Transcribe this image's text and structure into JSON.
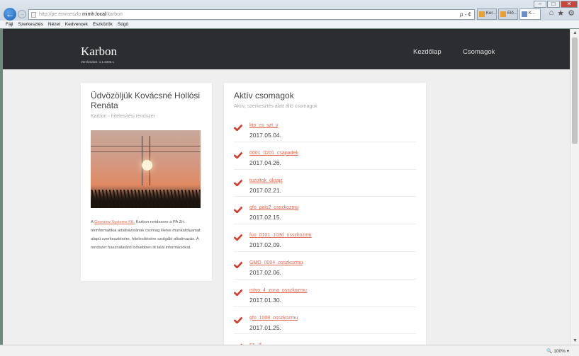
{
  "browser": {
    "address_prefix": "http://",
    "address_path_before": "pe.emmeszlo.",
    "address_host": "mimh.local",
    "address_path_after": "/karbon",
    "tools": "ρ - ¢",
    "tabs": [
      {
        "label": "Ker..."
      },
      {
        "label": "Elő..."
      },
      {
        "label": "K..."
      }
    ],
    "menu": [
      "Fájl",
      "Szerkesztés",
      "Nézet",
      "Kedvencek",
      "Eszközök",
      "Súgó"
    ],
    "zoom": "100%"
  },
  "site": {
    "title": "Karbon",
    "version": "Verziószám: 1.1.2203.1",
    "nav": {
      "home": "Kezdőlap",
      "packages": "Csomagok"
    }
  },
  "welcome": {
    "title": "Üdvözöljük Kovácsné Hollósi Renáta",
    "subtitle": "Karbon - hitelesítési rendszer",
    "desc_prefix": "A ",
    "desc_link": "Geoview Systems Kft.",
    "desc_rest": " Karbon rendszere a PA Zrt. térinformatikai adatbázisának csomag illetve munkafolyamat alapú szerkesztésére, hitelesítésére szolgáló alkalmazás. A rendszer használatáról bővebben itt talál információkat."
  },
  "packages": {
    "title": "Aktív csomagok",
    "subtitle": "Aktív, szerkesztés alatt álló csomagok",
    "items": [
      {
        "name": "kto_cs_szt_v",
        "date": "2017.05.04."
      },
      {
        "name": "0001_0201_csapadek",
        "date": "2017.04.26."
      },
      {
        "name": "tuzoltok_okrajz",
        "date": "2017.02.21."
      },
      {
        "name": "gfo_pals2_osszkozmu",
        "date": "2017.02.15."
      },
      {
        "name": "fuo_0101_103d_osszkozmu",
        "date": "2017.02.09."
      },
      {
        "name": "GMO_0004_osszkozmu",
        "date": "2017.02.06."
      },
      {
        "name": "mtvo_4_zona_osszkozmu",
        "date": "2017.01.30."
      },
      {
        "name": "gfo_1008_osszkozmu",
        "date": "2017.01.25."
      },
      {
        "name": "sz...d",
        "date": ""
      }
    ]
  },
  "colors": {
    "accent": "#e06b55",
    "header_bg": "#2b2d30",
    "check": "#d8392b"
  }
}
